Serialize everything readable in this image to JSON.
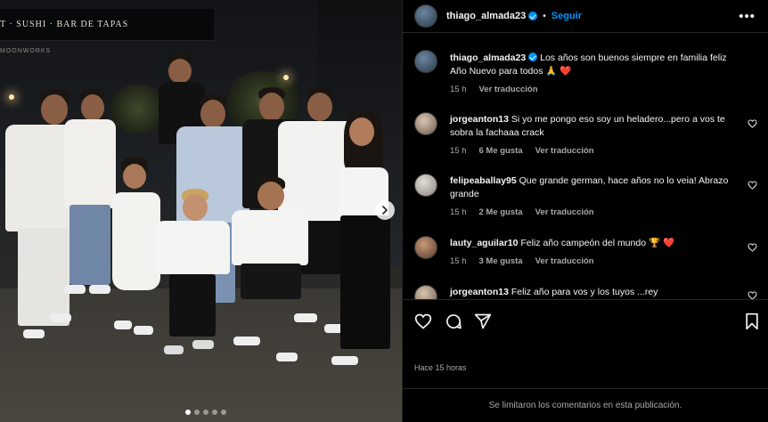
{
  "photo": {
    "sign_text": "T · SUSHI · BAR DE TAPAS",
    "sign_small": "MOONWORKS",
    "carousel_icon": "chevron-right-icon",
    "dots_count": 5,
    "active_dot": 0
  },
  "header": {
    "username": "thiago_almada23",
    "follow_label": "Seguir",
    "separator": "•",
    "more_icon": "more-horizontal-icon"
  },
  "caption": {
    "username": "thiago_almada23",
    "text": "Los años son buenos siempre en familia feliz Año Nuevo para todos 🙏 ❤️",
    "time": "15 h",
    "translate": "Ver traducción"
  },
  "comments": [
    {
      "username": "jorgeanton13",
      "text": "Si yo me pongo eso soy un heladero...pero a vos te sobra la fachaaa crack",
      "time": "15 h",
      "likes": "6 Me gusta",
      "translate": "Ver traducción"
    },
    {
      "username": "felipeaballay95",
      "text": "Que grande german, hace años no lo veia! Abrazo grande",
      "time": "15 h",
      "likes": "2 Me gusta",
      "translate": "Ver traducción"
    },
    {
      "username": "lauty_aguilar10",
      "text": "Feliz año campeón del mundo 🏆 ❤️",
      "time": "15 h",
      "likes": "3 Me gusta",
      "translate": "Ver traducción"
    },
    {
      "username": "jorgeanton13",
      "text": "Feliz año para vos y los tuyos ...rey",
      "time": "",
      "likes": "",
      "translate": ""
    }
  ],
  "actions": {
    "like_icon": "heart-icon",
    "comment_icon": "comment-icon",
    "share_icon": "share-icon",
    "save_icon": "bookmark-icon",
    "posted_time": "Hace 15 horas"
  },
  "footer": {
    "text": "Se limitaron los comentarios en esta publicación."
  },
  "colors": {
    "background": "#000000",
    "accent": "#0095f6",
    "secondary_text": "#a8a8a8",
    "heart_red": "#ff3040",
    "divider": "#262626"
  }
}
